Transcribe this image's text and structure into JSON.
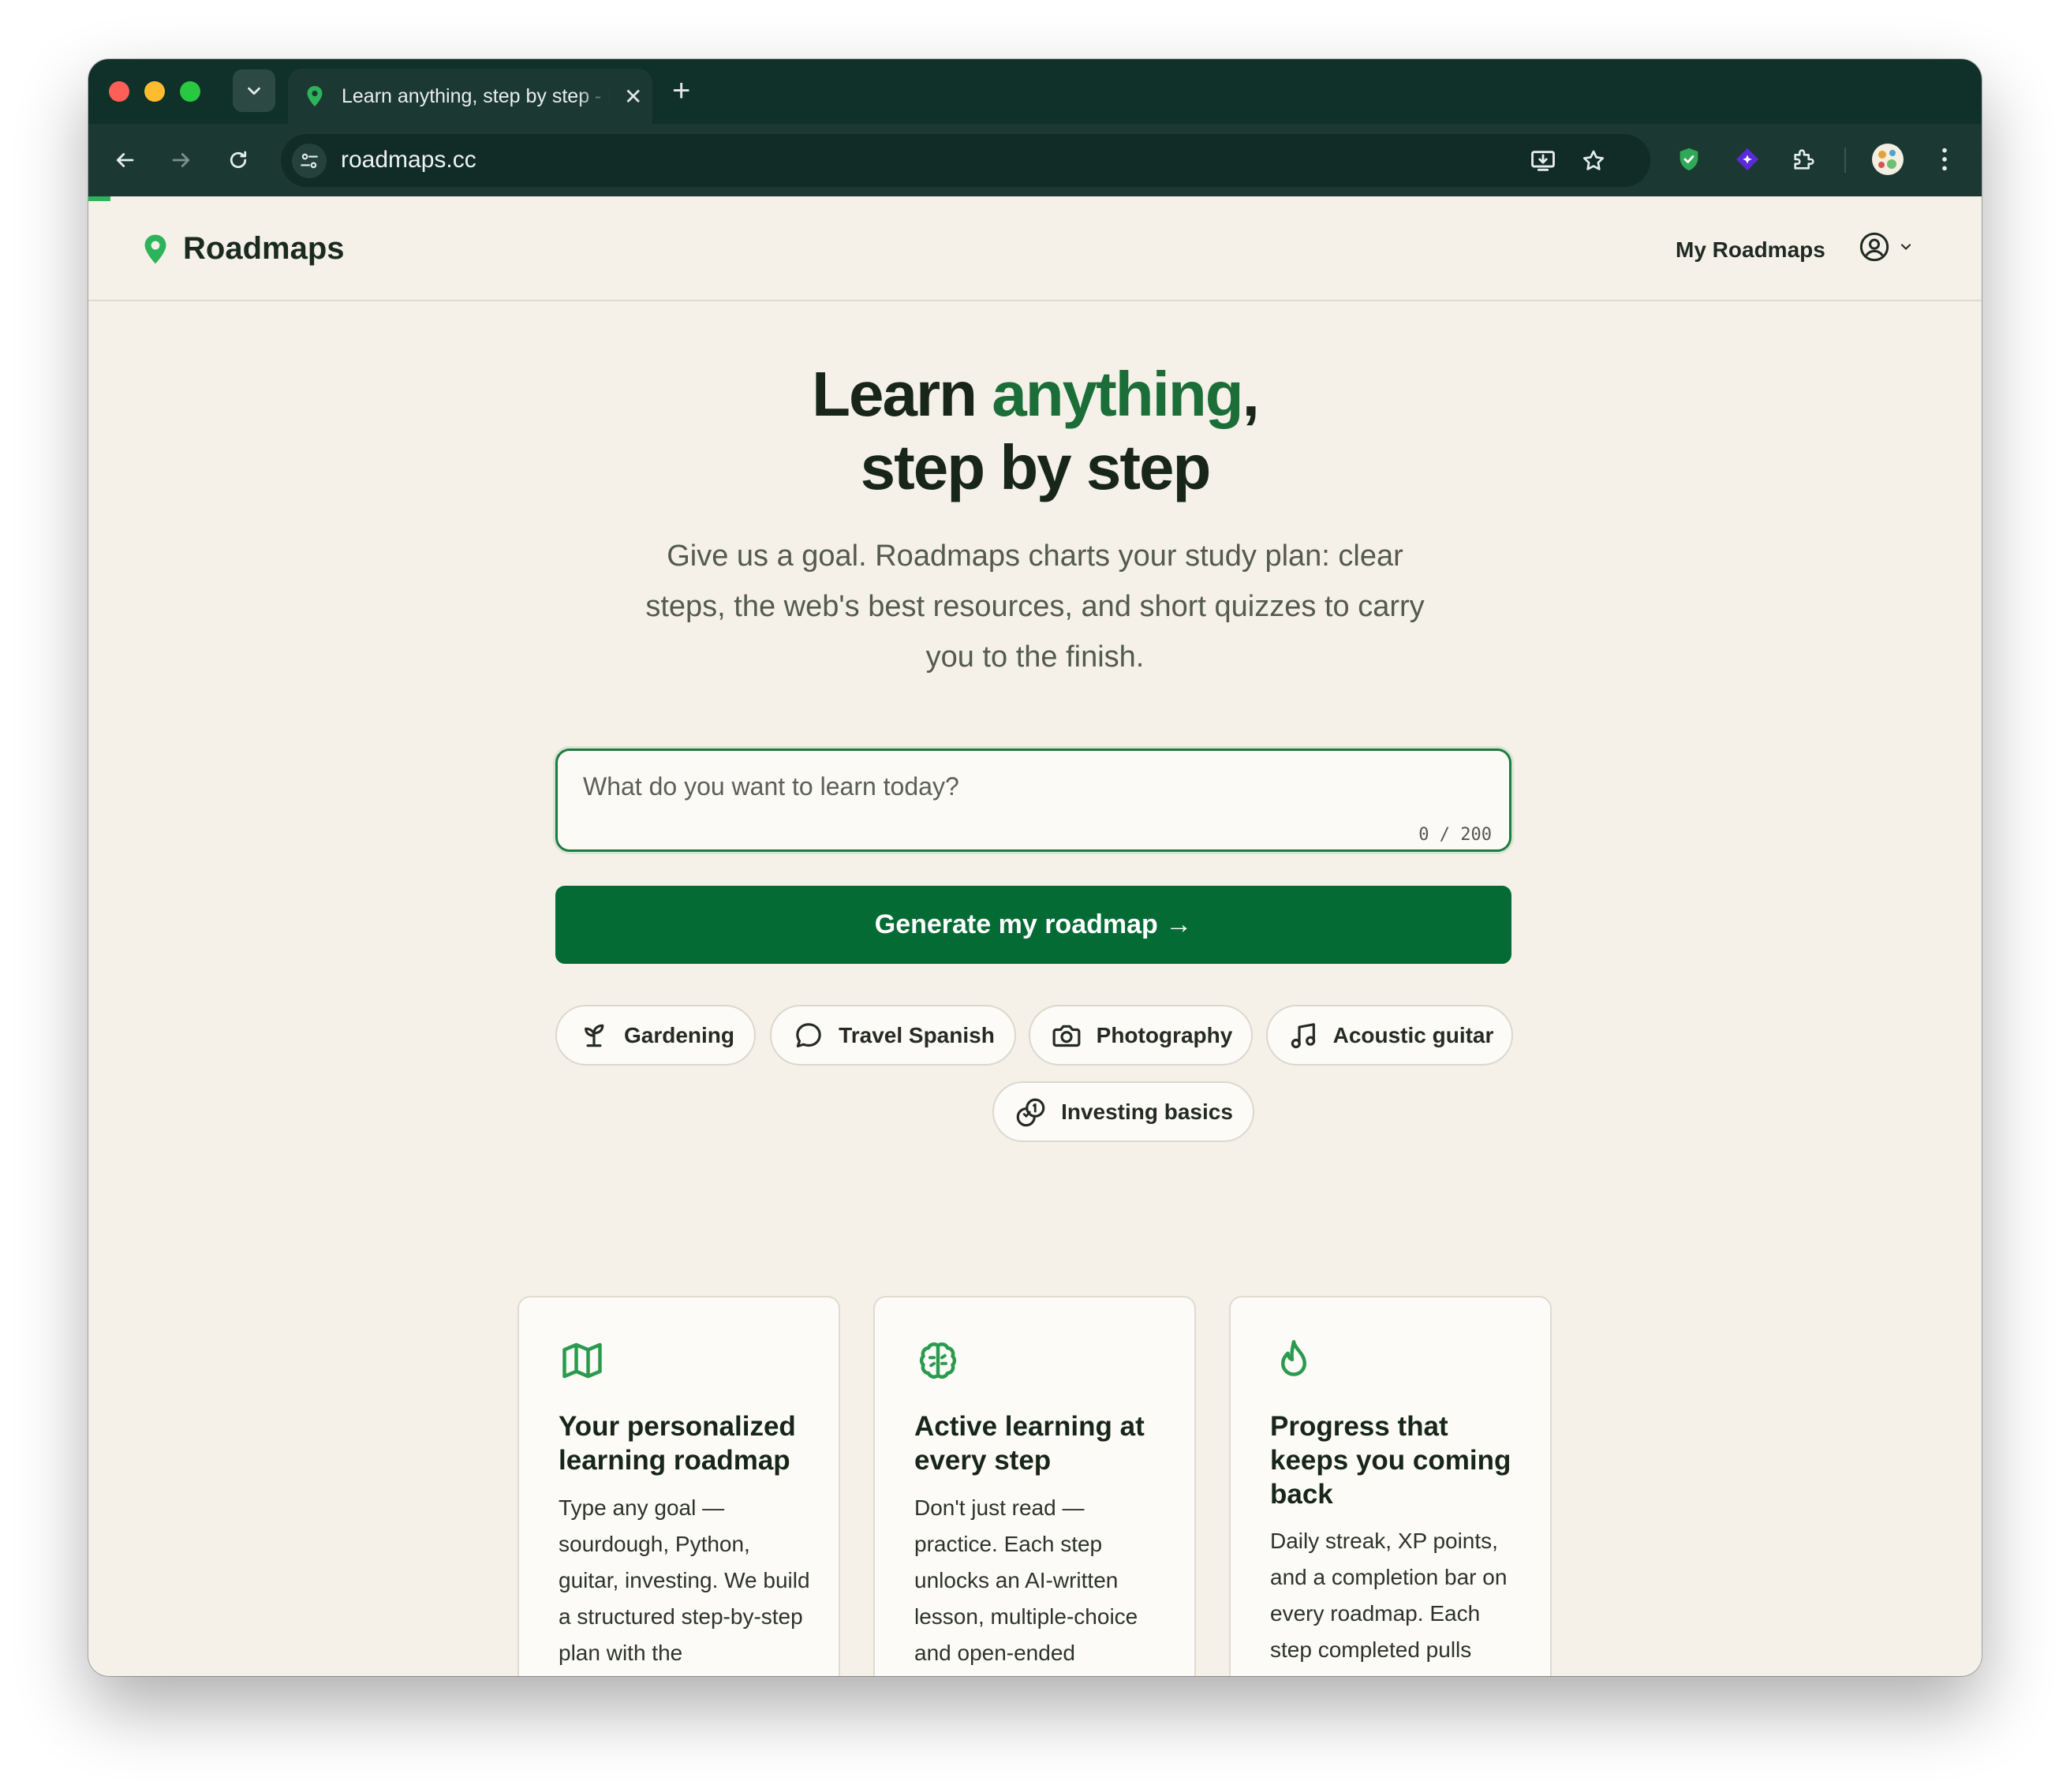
{
  "browser": {
    "tab_title": "Learn anything, step by step - Roadmaps",
    "url": "roadmaps.cc"
  },
  "header": {
    "brand_name": "Roadmaps",
    "my_roadmaps_label": "My Roadmaps"
  },
  "hero": {
    "title_part1": "Learn ",
    "title_accent": "anything",
    "title_part2": ",",
    "title_line2": "step by step",
    "subtitle": "Give us a goal. Roadmaps charts your study plan: clear steps, the web's best resources, and short quizzes to carry you to the finish."
  },
  "goal_input": {
    "placeholder": "What do you want to learn today?",
    "value": "",
    "counter": "0 / 200"
  },
  "generate_button_label": "Generate my roadmap →",
  "suggestions": [
    {
      "label": "Gardening",
      "icon": "sprout-icon"
    },
    {
      "label": "Travel Spanish",
      "icon": "speech-bubble-icon"
    },
    {
      "label": "Photography",
      "icon": "camera-icon"
    },
    {
      "label": "Acoustic guitar",
      "icon": "music-note-icon"
    },
    {
      "label": "Investing basics",
      "icon": "coins-icon"
    }
  ],
  "features": [
    {
      "icon": "map-icon",
      "title": "Your personalized learning roadmap",
      "body": "Type any goal — sourdough, Python, guitar, investing. We build a structured step-by-step plan with the"
    },
    {
      "icon": "brain-icon",
      "title": "Active learning at every step",
      "body": "Don't just read — practice. Each step unlocks an AI-written lesson, multiple-choice and open-ended"
    },
    {
      "icon": "flame-icon",
      "title": "Progress that keeps you coming back",
      "body": "Daily streak, XP points, and a completion bar on every roadmap. Each step completed pulls"
    }
  ],
  "colors": {
    "brand_green": "#046b35",
    "accent_green": "#1b6e38",
    "page_background": "#f5f1e9",
    "chrome_dark": "#10302a"
  }
}
